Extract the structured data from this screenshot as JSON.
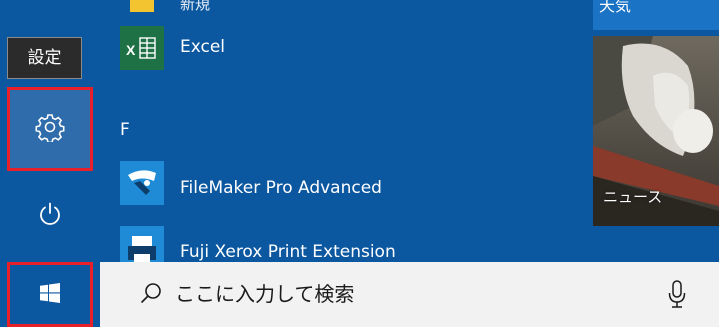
{
  "rail": {
    "tooltip": "設定",
    "settings_icon": "gear-icon",
    "power_icon": "power-icon"
  },
  "apps": {
    "partial_top_label": "新規",
    "excel": {
      "label": "Excel",
      "icon": "excel-icon"
    },
    "group_letter": "F",
    "filemaker": {
      "label": "FileMaker Pro Advanced",
      "icon": "filemaker-icon"
    },
    "fujixerox": {
      "label": "Fuji Xerox Print Extension",
      "icon": "printer-icon"
    }
  },
  "tiles": {
    "weather_label": "天気",
    "news_label": "ニュース"
  },
  "taskbar": {
    "start_icon": "windows-logo-icon",
    "search_placeholder": "ここに入力して検索",
    "search_icon": "search-icon",
    "mic_icon": "microphone-icon"
  },
  "colors": {
    "start_blue": "#0b57a0",
    "highlight_red": "#e8202a",
    "excel_green": "#1e7145",
    "filemaker_bg": "#1f8bd6",
    "search_bg": "#f2f2f2"
  }
}
